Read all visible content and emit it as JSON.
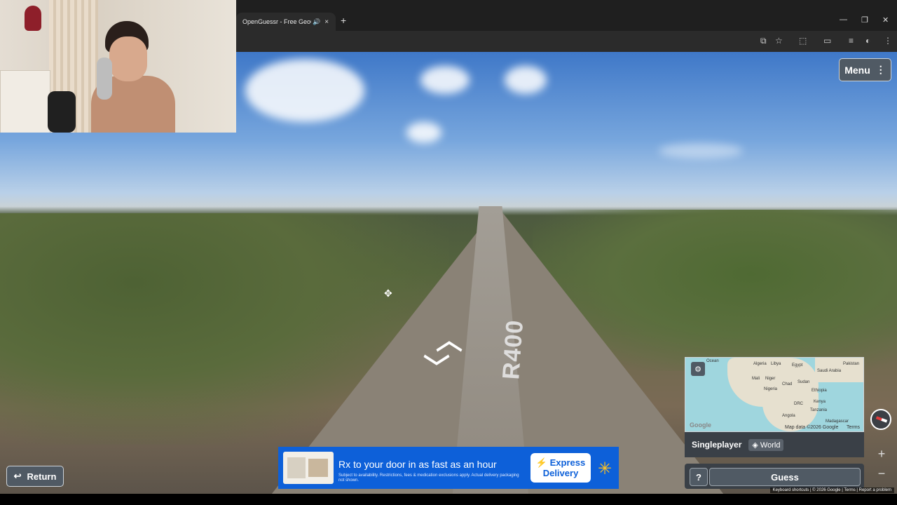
{
  "browser": {
    "tab_title": "OpenGuessr - Free GeoGuessr",
    "new_tab": "+",
    "tab_audio_icon": "speaker-icon",
    "tab_close": "×",
    "minimize": "—",
    "restore": "❐",
    "close": "✕"
  },
  "game": {
    "menu_label": "Menu",
    "road_marking": "R400",
    "mode": "Singleplayer",
    "map_name": "World",
    "guess_label": "Guess",
    "help_label": "?",
    "return_label": "Return",
    "zoom_in": "+",
    "zoom_out": "−",
    "minimap": {
      "attribution": "Map data ©2026 Google",
      "terms": "Terms",
      "google_logo": "Google",
      "labels": [
        "Algeria",
        "Libya",
        "Egypt",
        "Saudi Arabia",
        "Pakistan",
        "Mali",
        "Niger",
        "Chad",
        "Sudan",
        "Nigeria",
        "Ethiopia",
        "DRC",
        "Kenya",
        "Tanzania",
        "Angola",
        "Madagascar",
        "Ocean"
      ]
    }
  },
  "ad": {
    "title": "Rx to your door in as fast as an hour",
    "subtitle": "Subject to availability. Restrictions, fees & medication exclusions apply. Actual delivery packaging not shown.",
    "cta_line1": "Express",
    "cta_line2": "Delivery",
    "image_text": "Walmart"
  },
  "footer": {
    "links": "Keyboard shortcuts  |  © 2026 Google  |  Terms  |  Report a problem"
  }
}
